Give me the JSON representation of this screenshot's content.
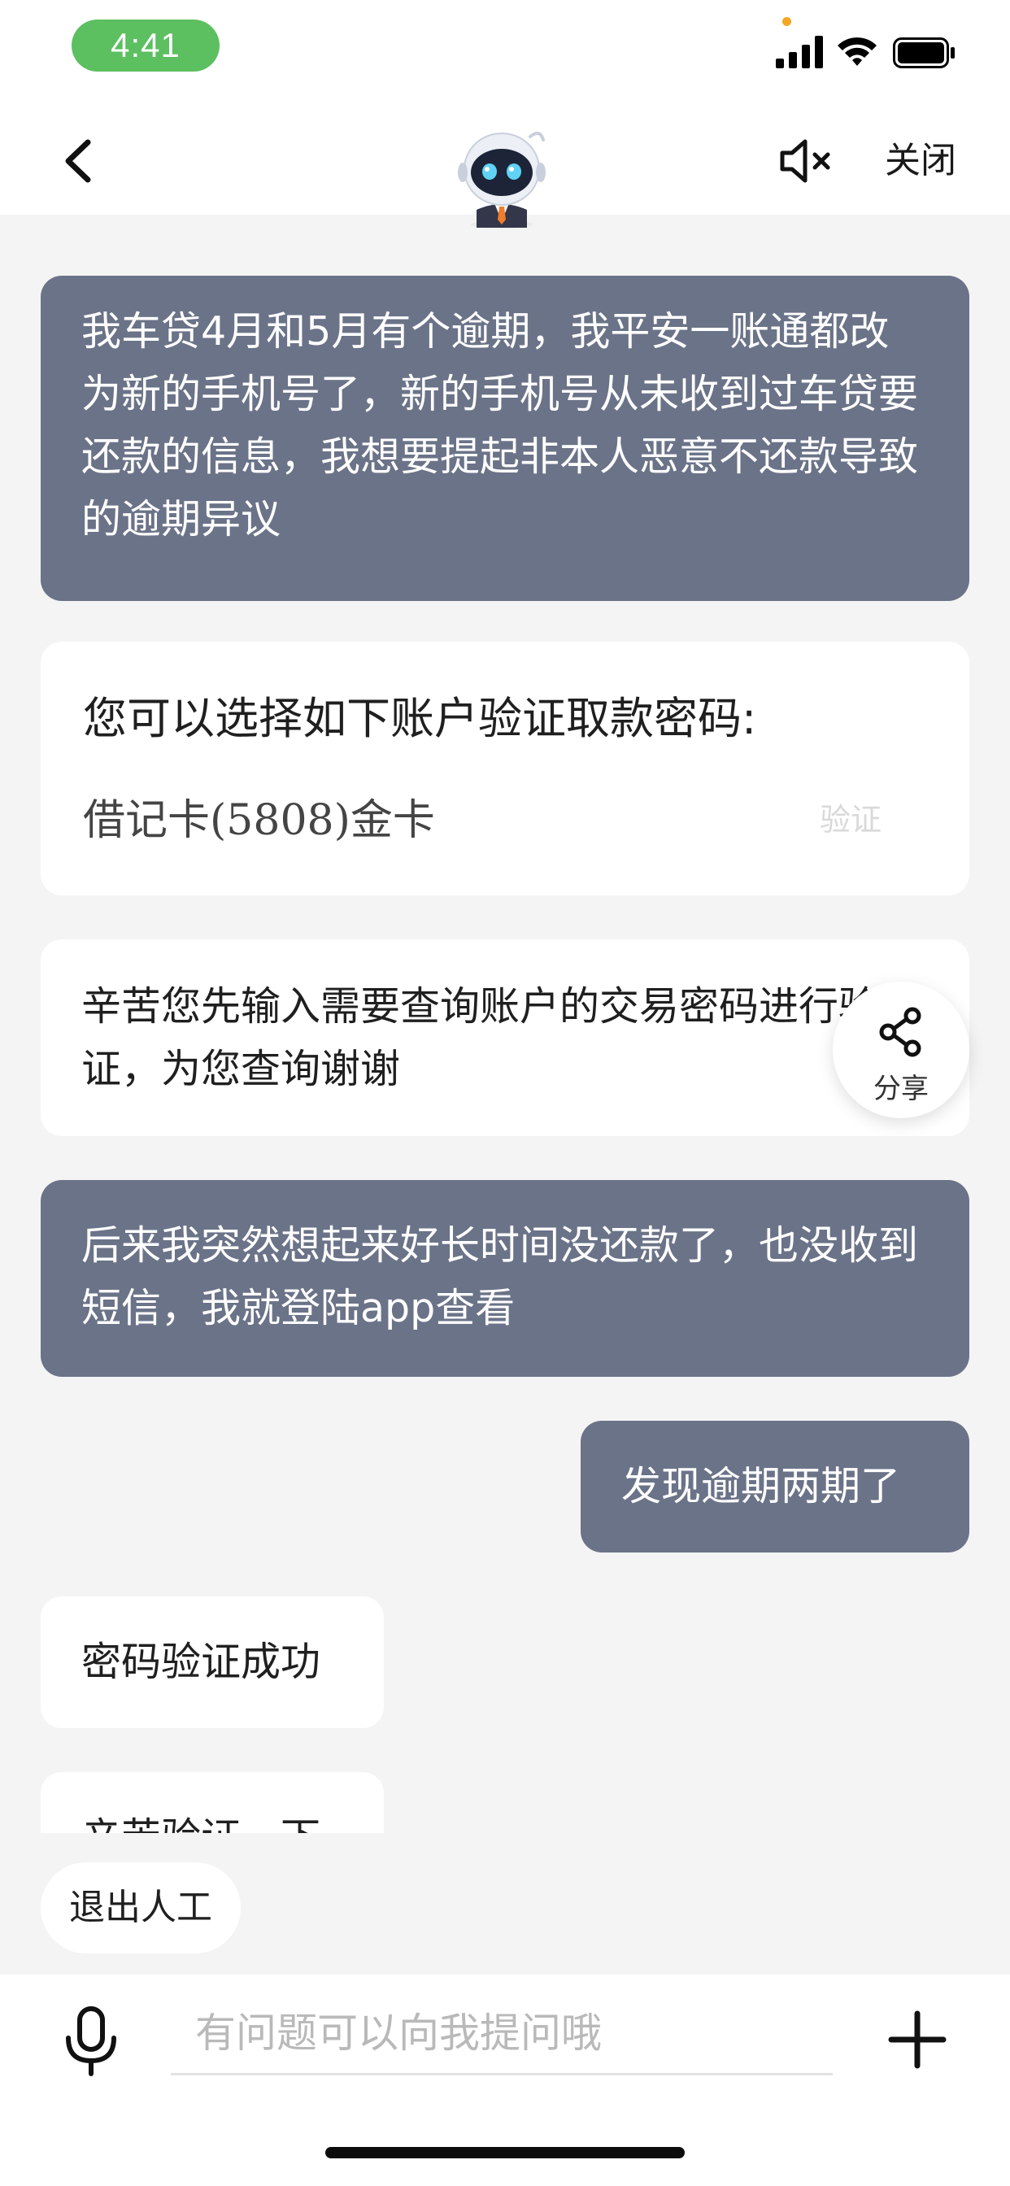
{
  "status_bar": {
    "time": "4:41",
    "icons": [
      "signal-icon",
      "wifi-icon",
      "battery-icon"
    ],
    "time_pill_color": "#5cbf60"
  },
  "header": {
    "back_icon": "chevron-left-icon",
    "avatar_icon": "robot-assistant-icon",
    "mute_icon": "speaker-muted-icon",
    "close_label": "关闭"
  },
  "messages": [
    {
      "role": "user",
      "text": "我车贷4月和5月有个逾期，我平安一账通都改为新的手机号了，新的手机号从未收到过车贷要还款的信息，我想要提起非本人恶意不还款导致的逾期异议"
    },
    {
      "role": "bot",
      "title": "您可以选择如下账户验证取款密码:",
      "card": "借记卡(5808)金卡",
      "action": "验证"
    },
    {
      "role": "bot",
      "text": "辛苦您先输入需要查询账户的交易密码进行验证，为您查询谢谢"
    },
    {
      "role": "user",
      "text": "后来我突然想起来好长时间没还款了，也没收到短信，我就登陆app查看"
    },
    {
      "role": "user",
      "text": "发现逾期两期了"
    },
    {
      "role": "bot",
      "text": "密码验证成功"
    },
    {
      "role": "bot",
      "text": "辛苦验证一下"
    }
  ],
  "share": {
    "label": "分享",
    "icon": "share-icon"
  },
  "quit_human_label": "退出人工",
  "input": {
    "placeholder": "有问题可以向我提问哦",
    "value": "",
    "mic_icon": "microphone-icon",
    "plus_icon": "plus-icon"
  },
  "colors": {
    "user_bubble": "#6b7388",
    "bot_bubble": "#ffffff",
    "background": "#f4f4f4"
  }
}
